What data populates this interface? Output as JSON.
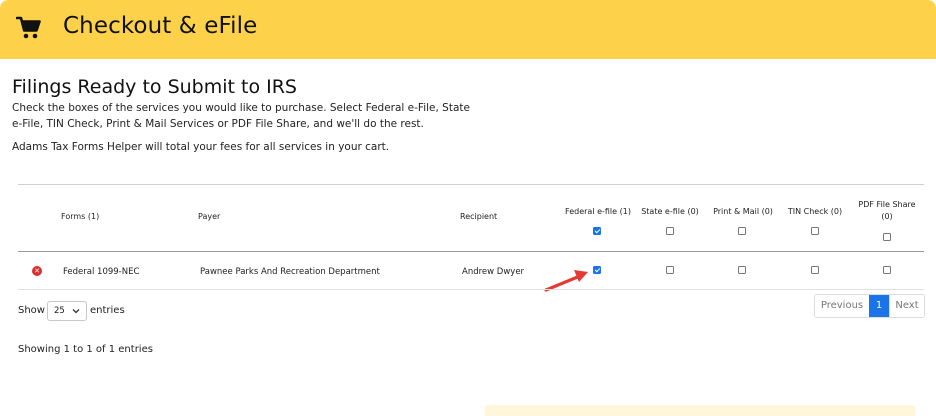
{
  "header": {
    "title": "Checkout & eFile",
    "icon": "shopping-cart-icon",
    "background": "#fdd24a"
  },
  "main": {
    "title": "Filings Ready to Submit to IRS",
    "intro": "Check the boxes of the services you would like to purchase. Select Federal e-File, State e-File, TIN Check, Print & Mail Services or PDF File Share, and we'll do the rest.",
    "fees_note": "Adams Tax Forms Helper will total your fees for all services in your cart."
  },
  "table": {
    "headers": {
      "forms": "Forms (1)",
      "payer": "Payer",
      "recipient": "Recipient",
      "federal_efile": "Federal e-file (1)",
      "state_efile": "State e-file (0)",
      "print_mail": "Print & Mail (0)",
      "tin_check": "TIN Check (0)",
      "pdf_share_line1": "PDF File Share",
      "pdf_share_line2": "(0)"
    },
    "header_checks": {
      "federal_efile": true,
      "state_efile": false,
      "print_mail": false,
      "tin_check": false,
      "pdf_share": false
    },
    "rows": [
      {
        "form": "Federal 1099-NEC",
        "payer": "Pawnee Parks And Recreation Department",
        "recipient": "Andrew Dwyer",
        "federal_efile": true,
        "state_efile": false,
        "print_mail": false,
        "tin_check": false,
        "pdf_share": false
      }
    ]
  },
  "length_menu": {
    "show_label": "Show",
    "value": "25",
    "entries_label": "entries"
  },
  "pagination": {
    "previous": "Previous",
    "current": "1",
    "next": "Next"
  },
  "info": "Showing 1 to 1 of 1 entries",
  "colors": {
    "accent": "#1a73e8",
    "remove": "#d93030",
    "arrow": "#e53935"
  }
}
